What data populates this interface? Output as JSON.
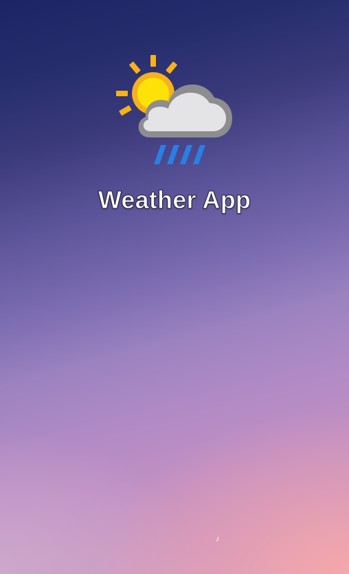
{
  "app": {
    "title": "Weather App"
  },
  "icon": {
    "name": "partly-cloudy-rain-icon",
    "colors": {
      "sun_rays": "#f6b21a",
      "sun_core": "#fde20a",
      "sun_ring": "#f6b21a",
      "cloud_fill": "#e4e4e6",
      "cloud_outline": "#8d8d90",
      "rain": "#2a7fe4"
    }
  },
  "background": {
    "gradient_top": "#1c2466",
    "gradient_middle": "#9b82c0",
    "gradient_bottom": "#f7a8a8"
  }
}
